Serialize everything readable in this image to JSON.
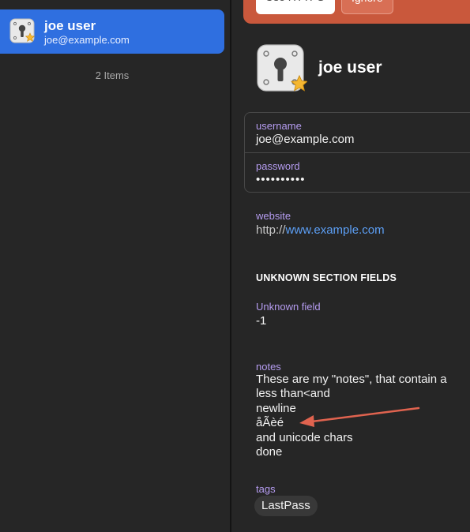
{
  "sidebar": {
    "item": {
      "title": "joe user",
      "subtitle": "joe@example.com"
    },
    "count_label": "2 Items"
  },
  "banner": {
    "primary_label": "Use HTTPS",
    "secondary_label": "Ignore"
  },
  "detail": {
    "title": "joe user",
    "username": {
      "label": "username",
      "value": "joe@example.com"
    },
    "password": {
      "label": "password",
      "value": "••••••••••"
    },
    "website": {
      "label": "website",
      "prefix": "http://",
      "link": "www.example.com"
    },
    "section_title": "UNKNOWN SECTION FIELDS",
    "unknown_field": {
      "label": "Unknown field",
      "value": "-1"
    },
    "notes": {
      "label": "notes",
      "lines": [
        "These are my \"notes\", that contain a",
        "less than<and",
        "newline",
        "åÃèé",
        "and unicode chars",
        "done"
      ]
    },
    "tags": {
      "label": "tags",
      "items": [
        "LastPass"
      ]
    }
  },
  "colors": {
    "selection": "#2f6fe0",
    "banner": "#c9583c",
    "field_label": "#b59cf0",
    "link": "#5c9ff5",
    "annotation_arrow": "#e0634f"
  },
  "icons": [
    "vault-lock-icon",
    "favorite-star-icon"
  ]
}
